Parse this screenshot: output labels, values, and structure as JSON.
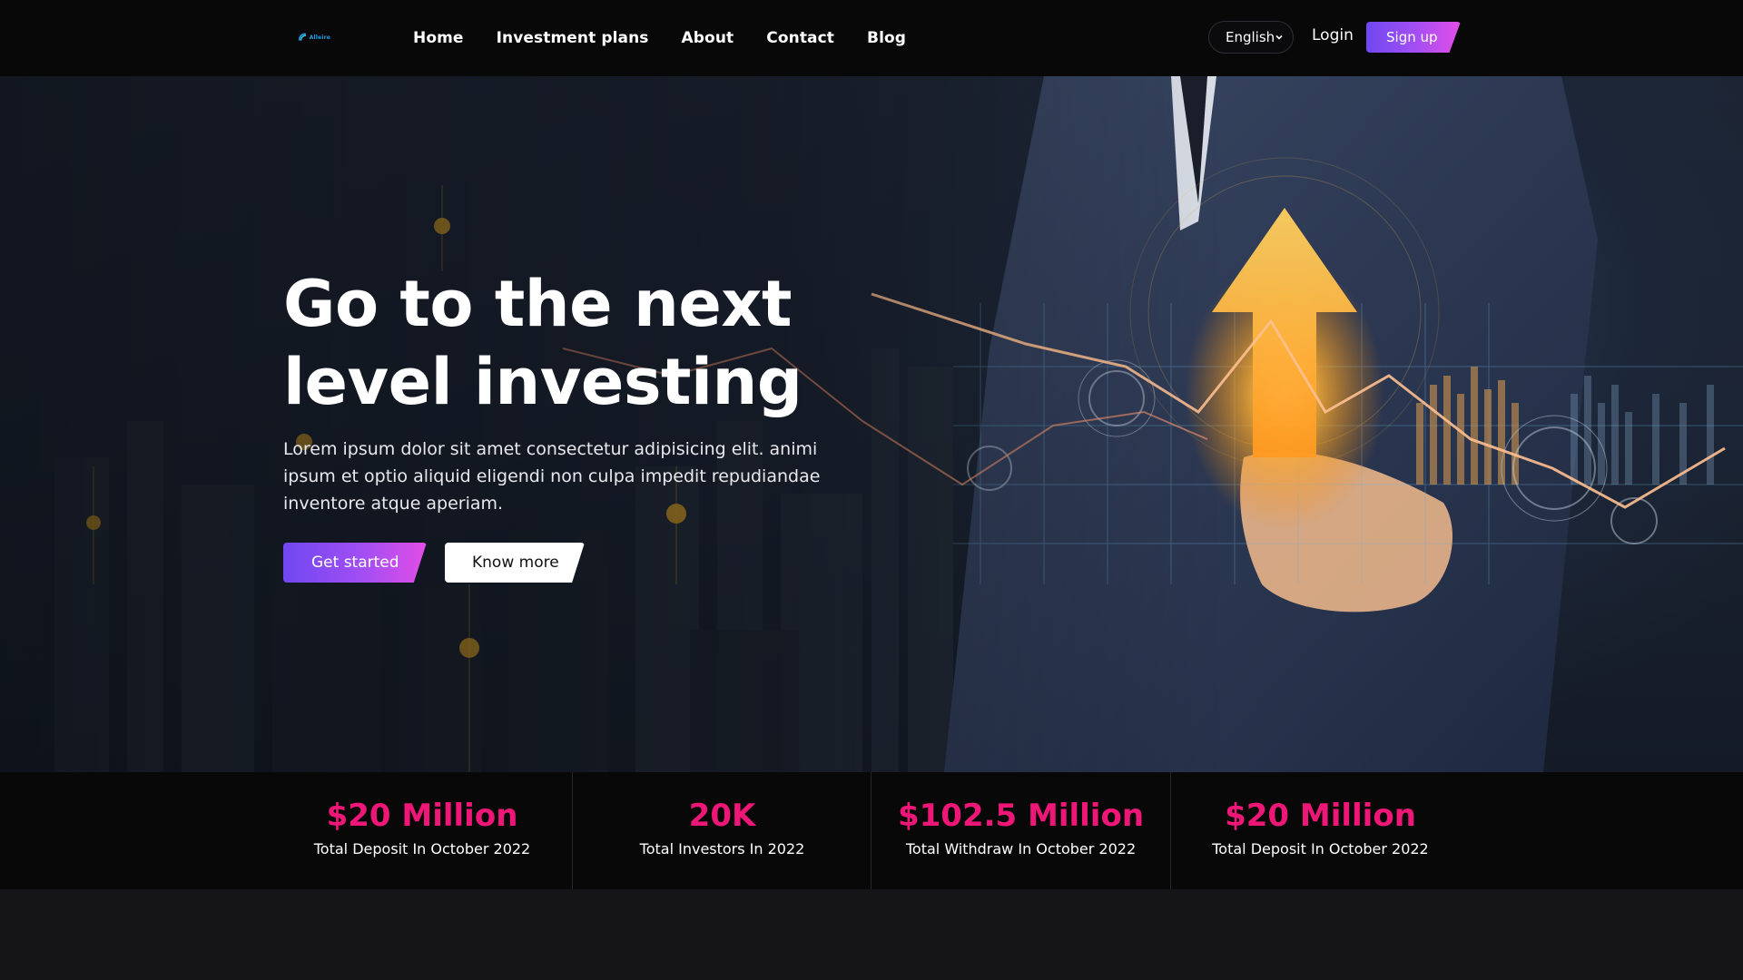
{
  "nav": {
    "logo_text": "Alleire",
    "links": [
      "Home",
      "Investment plans",
      "About",
      "Contact",
      "Blog"
    ],
    "language": "English",
    "login": "Login",
    "signup": "Sign up"
  },
  "hero": {
    "title": "Go to the next level investing",
    "description": "Lorem ipsum dolor sit amet consectetur adipisicing elit. animi ipsum et optio aliquid eligendi non culpa impedit repudiandae inventore atque aperiam.",
    "primary_button": "Get started",
    "secondary_button": "Know more"
  },
  "stats": [
    {
      "value": "$20 Million",
      "label": "Total Deposit In October 2022"
    },
    {
      "value": "20K",
      "label": "Total Investors In 2022"
    },
    {
      "value": "$102.5 Million",
      "label": "Total Withdraw In October 2022"
    },
    {
      "value": "$20 Million",
      "label": "Total Deposit In October 2022"
    }
  ],
  "colors": {
    "accent": "#ee1777",
    "button_gradient_start": "#7048f0",
    "button_gradient_end": "#e24ee6",
    "nav_background": "#080808"
  }
}
